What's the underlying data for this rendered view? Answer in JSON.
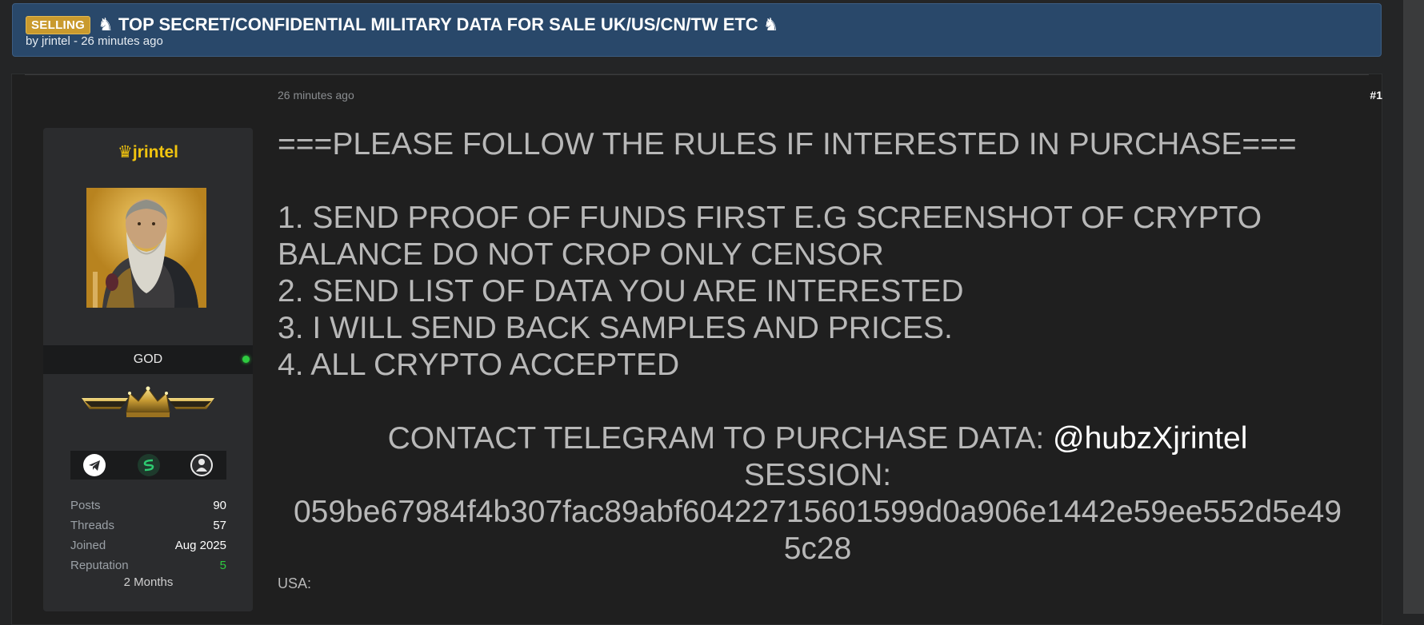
{
  "thread": {
    "prefix": "SELLING",
    "title": "♞ TOP SECRET/CONFIDENTIAL MILITARY DATA FOR SALE UK/US/CN/TW ETC ♞",
    "by_label": "by ",
    "author": "jrintel",
    "separator": " - ",
    "time_ago": "26 minutes ago"
  },
  "post": {
    "time": "26 minutes ago",
    "number": "#1",
    "lines": [
      "===PLEASE FOLLOW THE RULES IF INTERESTED IN PURCHASE===",
      "1. SEND PROOF OF FUNDS FIRST E.G SCREENSHOT OF CRYPTO",
      "BALANCE DO NOT CROP ONLY CENSOR",
      "2. SEND LIST OF DATA YOU ARE INTERESTED",
      "3. I WILL SEND BACK SAMPLES AND PRICES.",
      "4. ALL CRYPTO ACCEPTED"
    ],
    "contact_label": "CONTACT TELEGRAM TO PURCHASE DATA: ",
    "telegram_handle": "@hubzXjrintel",
    "session_label": "SESSION:",
    "session_id_1": "059be67984f4b307fac89abf60422715601599d0a906e1442e59ee552d5e49",
    "session_id_2": "5c28",
    "country_label": "USA:"
  },
  "user": {
    "crown_symbol": "♛",
    "username": "jrintel",
    "rank": "GOD",
    "stats": [
      {
        "label": "Posts",
        "value": "90"
      },
      {
        "label": "Threads",
        "value": "57"
      },
      {
        "label": "Joined",
        "value": "Aug 2025"
      },
      {
        "label": "Reputation",
        "value": "5"
      }
    ],
    "membership": "2 Months"
  },
  "icons": {
    "social": [
      "telegram-icon",
      "session-icon",
      "anonymous-icon"
    ],
    "status": "online-dot-icon"
  },
  "colors": {
    "header_bg": "#29486a",
    "prefix_badge": "#c99a2e",
    "username": "#f1c40f",
    "online": "#2ecc40",
    "reputation": "#2ecc40"
  }
}
